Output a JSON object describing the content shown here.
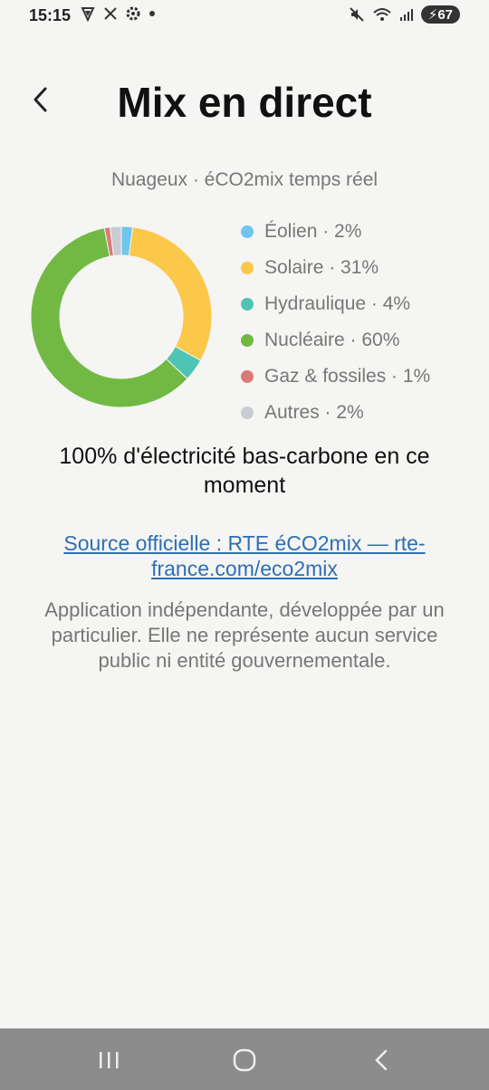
{
  "status": {
    "time": "15:15",
    "battery": "67"
  },
  "header": {
    "title": "Mix en direct"
  },
  "subtitle": "Nuageux · éCO2mix temps réel",
  "mix": [
    {
      "label": "Éolien · 2%",
      "percent": 2,
      "color": "#6ec6ec"
    },
    {
      "label": "Solaire · 31%",
      "percent": 31,
      "color": "#fcc84a"
    },
    {
      "label": "Hydraulique · 4%",
      "percent": 4,
      "color": "#4fc4b4"
    },
    {
      "label": "Nucléaire · 60%",
      "percent": 60,
      "color": "#72b944"
    },
    {
      "label": "Gaz & fossiles · 1%",
      "percent": 1,
      "color": "#d97a78"
    },
    {
      "label": "Autres · 2%",
      "percent": 2,
      "color": "#c9ccd2"
    }
  ],
  "lowcarbon": "100% d'électricité bas-carbone en ce moment",
  "source_link": "Source officielle : RTE éCO2mix — rte-france.com/eco2mix",
  "disclaimer": "Application indépendante, développée par un particulier. Elle ne représente aucun service public ni entité gouvernementale."
}
